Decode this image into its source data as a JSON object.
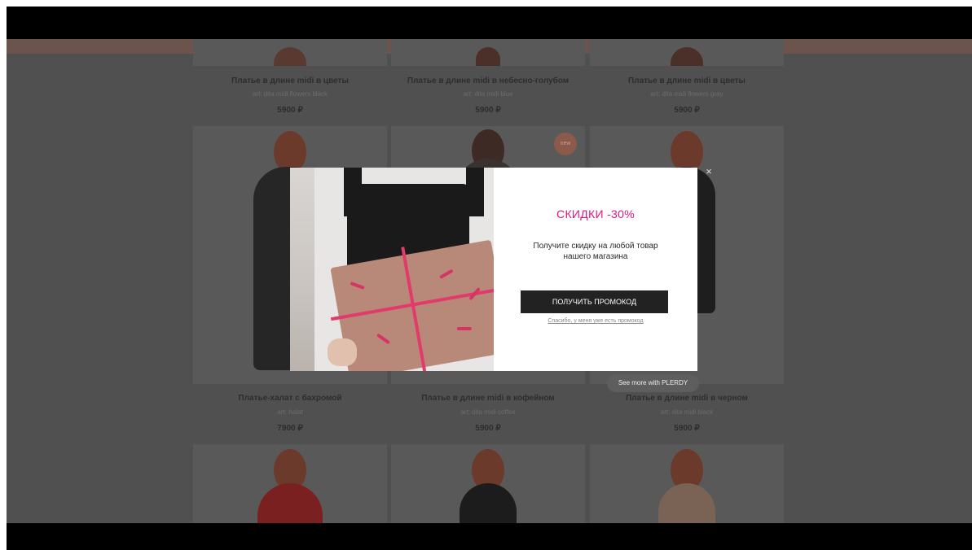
{
  "promo_strip": "",
  "products": [
    {
      "name": "Платье в длине midi в цветы",
      "art": "art: dita midi flowers black",
      "price": "5900 ₽"
    },
    {
      "name": "Платье в длине midi в небесно-голубом",
      "art": "art: dita midi blue",
      "price": "5900 ₽"
    },
    {
      "name": "Платье в длине midi в цветы",
      "art": "art: dita midi flowers gray",
      "price": "5900 ₽"
    },
    {
      "name": "Платье-халат с бахромой",
      "art": "art: halat",
      "price": "7900 ₽"
    },
    {
      "name": "Платье в длине midi в кофейном",
      "art": "art: dita midi coffee",
      "price": "5900 ₽"
    },
    {
      "name": "Платье в длине midi в черном",
      "art": "art: dita midi black",
      "price": "5900 ₽"
    }
  ],
  "badge": "new",
  "modal": {
    "title": "СКИДКИ -30%",
    "text": "Получите скидку на любой товар нашего магазина",
    "button": "ПОЛУЧИТЬ ПРОМОКОД",
    "link": "Спасибо, у меня уже есть промокод",
    "close": "×"
  },
  "plerdy_button": "See more with PLERDY",
  "colors": {
    "accent": "#e2157f",
    "button_bg": "#222222",
    "overlay": "#505050"
  },
  "icons": [
    "close-icon",
    "gift-image"
  ]
}
